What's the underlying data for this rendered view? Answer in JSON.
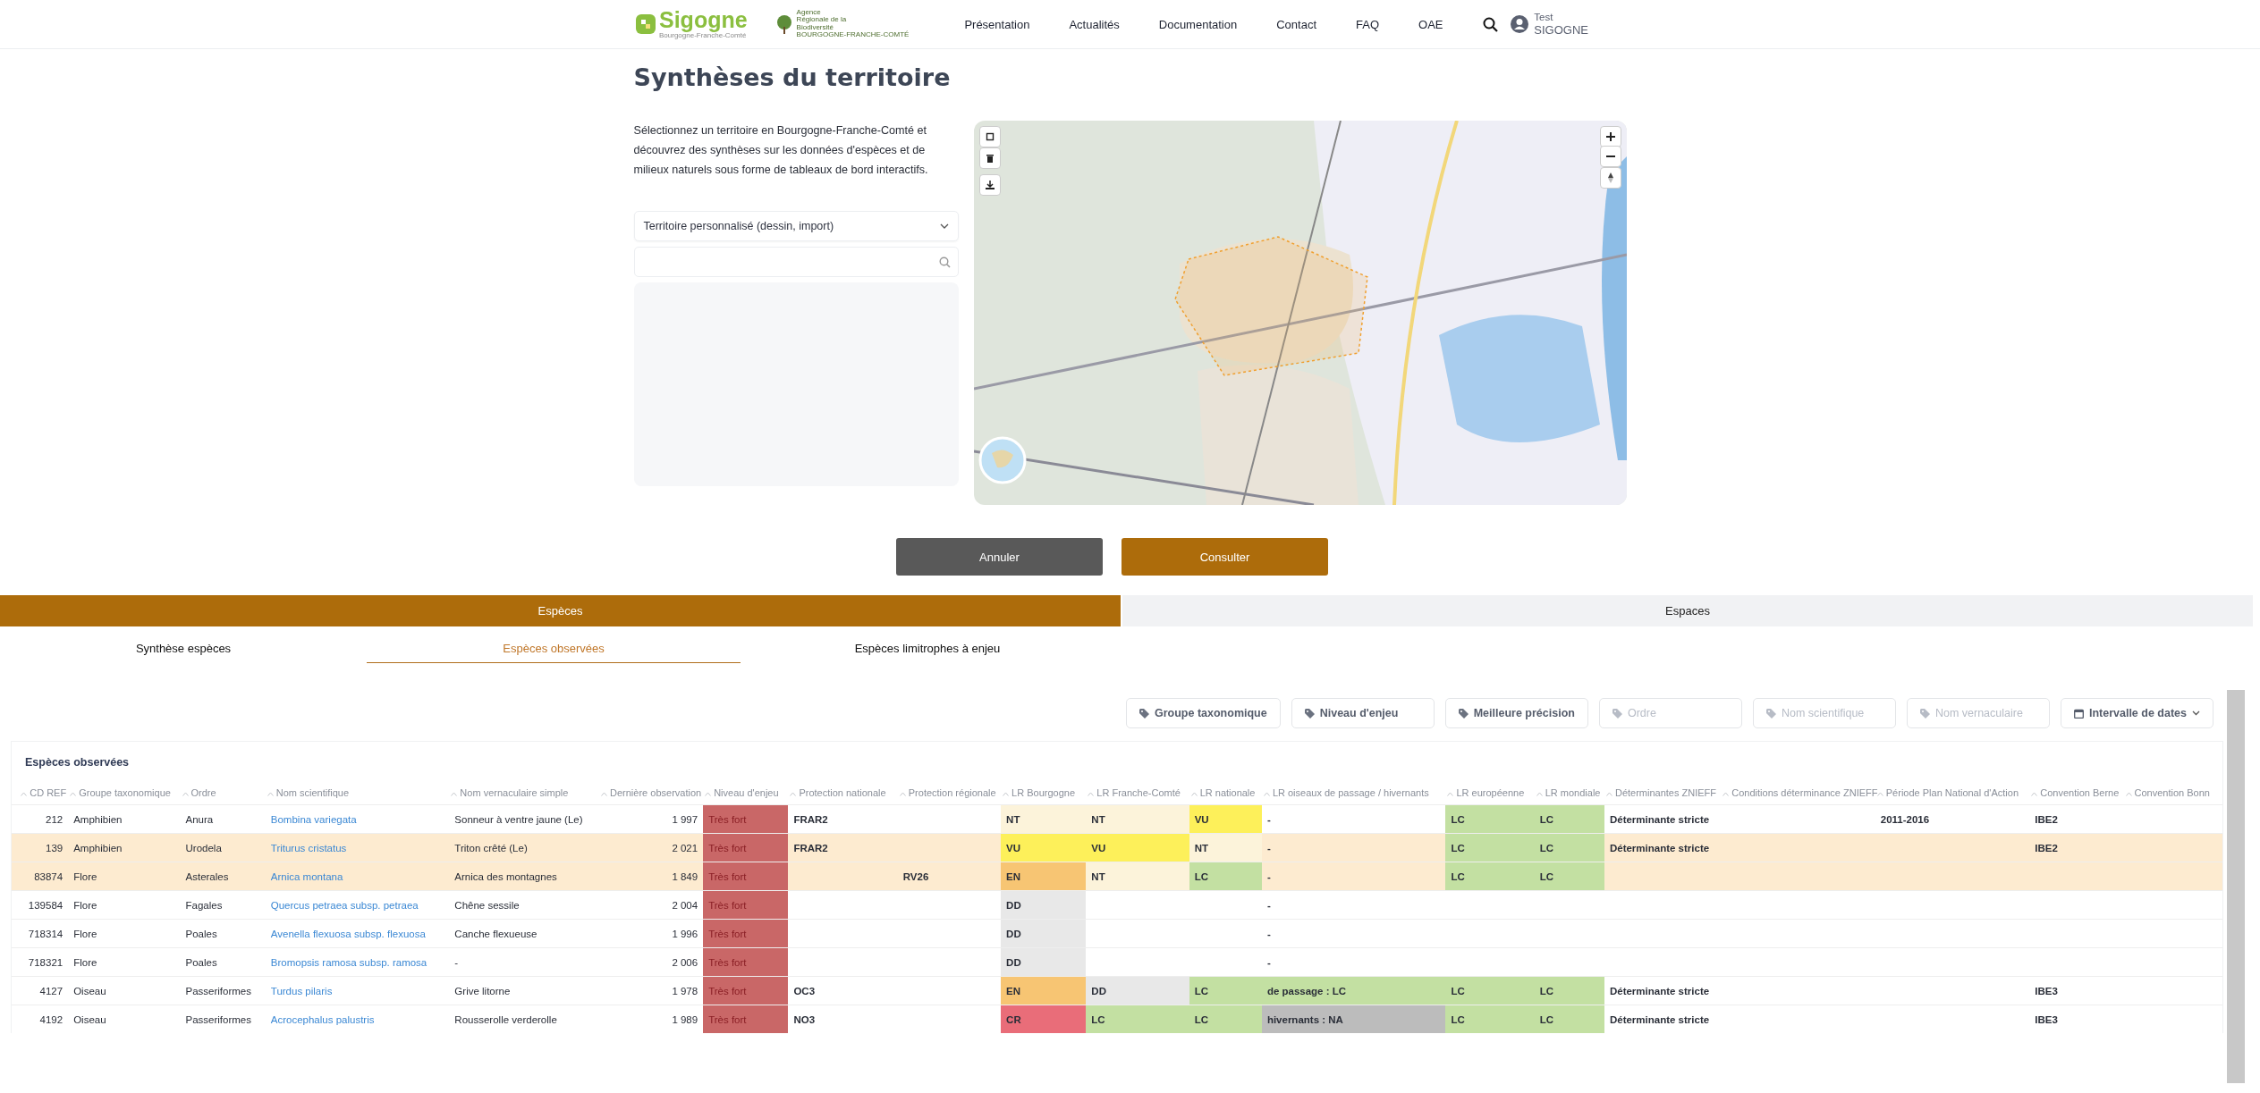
{
  "header": {
    "logo": {
      "name": "Sigogne",
      "tagline": "Bourgogne-Franche-Comté"
    },
    "partner_logo": {
      "lines": [
        "Agence",
        "Régionale de la",
        "Biodiversité"
      ],
      "region": "BOURGOGNE-FRANCHE-COMTÉ"
    },
    "nav": [
      "Présentation",
      "Actualités",
      "Documentation",
      "Contact",
      "FAQ",
      "OAE"
    ],
    "user": {
      "first": "Test",
      "last": "SIGOGNE"
    }
  },
  "title": "Synthèses du territoire",
  "intro": "Sélectionnez un territoire en Bourgogne-Franche-Comté et découvrez des synthèses sur les données d'espèces et de milieux naturels sous forme de tableaux de bord interactifs.",
  "territory_select": {
    "value": "Territoire personnalisé (dessin, import)"
  },
  "buttons": [
    {
      "label": "Annuler",
      "kind": "secondary"
    },
    {
      "label": "Consulter",
      "kind": "primary"
    }
  ],
  "main_tabs": [
    {
      "label": "Espèces",
      "selected": true
    },
    {
      "label": "Espaces",
      "selected": false
    }
  ],
  "sub_tabs": [
    {
      "label": "Synthèse espèces",
      "selected": false
    },
    {
      "label": "Espèces observées",
      "selected": true
    },
    {
      "label": "Espèces limitrophes à enjeu",
      "selected": false
    }
  ],
  "filters": [
    {
      "label": "Groupe taxonomique",
      "kind": "tag",
      "disabled": false
    },
    {
      "label": "Niveau d'enjeu",
      "kind": "tag",
      "disabled": false
    },
    {
      "label": "Meilleure précision",
      "kind": "tag",
      "disabled": false
    },
    {
      "label": "Ordre",
      "kind": "tag",
      "disabled": true
    },
    {
      "label": "Nom scientifique",
      "kind": "tag",
      "disabled": true
    },
    {
      "label": "Nom vernaculaire",
      "kind": "tag",
      "disabled": true
    },
    {
      "label": "Intervalle de dates",
      "kind": "date",
      "disabled": false
    }
  ],
  "table": {
    "title": "Espèces observées",
    "columns": [
      {
        "label": "CD REF",
        "kind": "number"
      },
      {
        "label": "Groupe taxonomique",
        "kind": "text"
      },
      {
        "label": "Ordre",
        "kind": "text"
      },
      {
        "label": "Nom scientifique",
        "kind": "link"
      },
      {
        "label": "Nom vernaculaire simple",
        "kind": "text"
      },
      {
        "label": "Dernière observation",
        "kind": "number"
      },
      {
        "label": "Niveau d'enjeu",
        "kind": "level"
      },
      {
        "label": "Protection nationale",
        "kind": "text"
      },
      {
        "label": "Protection régionale",
        "kind": "text"
      },
      {
        "label": "LR Bourgogne",
        "kind": "status"
      },
      {
        "label": "LR Franche-Comté",
        "kind": "status"
      },
      {
        "label": "LR nationale",
        "kind": "status"
      },
      {
        "label": "LR oiseaux de passage / hivernants",
        "kind": "status"
      },
      {
        "label": "LR européenne",
        "kind": "status"
      },
      {
        "label": "LR mondiale",
        "kind": "status"
      },
      {
        "label": "Déterminantes ZNIEFF",
        "kind": "text"
      },
      {
        "label": "Conditions déterminance ZNIEFF",
        "kind": "text"
      },
      {
        "label": "Période Plan National d'Action",
        "kind": "text"
      },
      {
        "label": "Convention Berne",
        "kind": "text"
      },
      {
        "label": "Convention Bonn",
        "kind": "text"
      }
    ],
    "rows": [
      {
        "highlighted": false,
        "cells": [
          "212",
          "Amphibien",
          "Anura",
          "Bombina variegata",
          "Sonneur à ventre jaune (Le)",
          "1 997",
          {
            "text": "Très fort",
            "color": "#c96767"
          },
          "FRAR2",
          null,
          {
            "text": "NT",
            "color": "#fcf3da"
          },
          {
            "text": "NT",
            "color": "#fcf3da"
          },
          {
            "text": "VU",
            "color": "#fdf05a"
          },
          {
            "text": "-"
          },
          {
            "text": "LC",
            "color": "#c3e0a2"
          },
          {
            "text": "LC",
            "color": "#c3e0a2"
          },
          "Déterminante stricte",
          null,
          "2011-2016",
          "IBE2",
          null
        ]
      },
      {
        "highlighted": true,
        "cells": [
          "139",
          "Amphibien",
          "Urodela",
          "Triturus cristatus",
          "Triton crêté (Le)",
          "2 021",
          {
            "text": "Très fort",
            "color": "#c96767"
          },
          "FRAR2",
          null,
          {
            "text": "VU",
            "color": "#fdf05a"
          },
          {
            "text": "VU",
            "color": "#fdf05a"
          },
          {
            "text": "NT",
            "color": "#fcf3da"
          },
          {
            "text": "-"
          },
          {
            "text": "LC",
            "color": "#c3e0a2"
          },
          {
            "text": "LC",
            "color": "#c3e0a2"
          },
          "Déterminante stricte",
          null,
          null,
          "IBE2",
          null
        ]
      },
      {
        "highlighted": true,
        "cells": [
          "83874",
          "Flore",
          "Asterales",
          "Arnica montana",
          "Arnica des montagnes",
          "1 849",
          {
            "text": "Très fort",
            "color": "#c96767"
          },
          null,
          "RV26",
          {
            "text": "EN",
            "color": "#f7c573"
          },
          {
            "text": "NT",
            "color": "#fcf3da"
          },
          {
            "text": "LC",
            "color": "#c3e0a2"
          },
          {
            "text": "-"
          },
          {
            "text": "LC",
            "color": "#c3e0a2"
          },
          {
            "text": "LC",
            "color": "#c3e0a2"
          },
          null,
          null,
          null,
          null,
          null
        ]
      },
      {
        "highlighted": false,
        "cells": [
          "139584",
          "Flore",
          "Fagales",
          "Quercus petraea subsp. petraea",
          "Chêne sessile",
          "2 004",
          {
            "text": "Très fort",
            "color": "#c96767"
          },
          null,
          null,
          {
            "text": "DD",
            "color": "#e8e8e8"
          },
          null,
          null,
          {
            "text": "-"
          },
          null,
          null,
          null,
          null,
          null,
          null,
          null
        ]
      },
      {
        "highlighted": false,
        "cells": [
          "718314",
          "Flore",
          "Poales",
          "Avenella flexuosa subsp. flexuosa",
          "Canche flexueuse",
          "1 996",
          {
            "text": "Très fort",
            "color": "#c96767"
          },
          null,
          null,
          {
            "text": "DD",
            "color": "#e8e8e8"
          },
          null,
          null,
          {
            "text": "-"
          },
          null,
          null,
          null,
          null,
          null,
          null,
          null
        ]
      },
      {
        "highlighted": false,
        "cells": [
          "718321",
          "Flore",
          "Poales",
          "Bromopsis ramosa subsp. ramosa",
          "-",
          "2 006",
          {
            "text": "Très fort",
            "color": "#c96767"
          },
          null,
          null,
          {
            "text": "DD",
            "color": "#e8e8e8"
          },
          null,
          null,
          {
            "text": "-"
          },
          null,
          null,
          null,
          null,
          null,
          null,
          null
        ]
      },
      {
        "highlighted": false,
        "cells": [
          "4127",
          "Oiseau",
          "Passeriformes",
          "Turdus pilaris",
          "Grive litorne",
          "1 978",
          {
            "text": "Très fort",
            "color": "#c96767"
          },
          "OC3",
          null,
          {
            "text": "EN",
            "color": "#f7c573"
          },
          {
            "text": "DD",
            "color": "#e8e8e8"
          },
          {
            "text": "LC",
            "color": "#c3e0a2"
          },
          {
            "text": "de passage : LC",
            "color": "#c3e0a2"
          },
          {
            "text": "LC",
            "color": "#c3e0a2"
          },
          {
            "text": "LC",
            "color": "#c3e0a2"
          },
          "Déterminante stricte",
          null,
          null,
          "IBE3",
          null
        ]
      },
      {
        "highlighted": false,
        "cells": [
          "4192",
          "Oiseau",
          "Passeriformes",
          "Acrocephalus palustris",
          "Rousserolle verderolle",
          "1 989",
          {
            "text": "Très fort",
            "color": "#c96767"
          },
          "NO3",
          null,
          {
            "text": "CR",
            "color": "#e96d79"
          },
          {
            "text": "LC",
            "color": "#c3e0a2"
          },
          {
            "text": "LC",
            "color": "#c3e0a2"
          },
          {
            "text": "hivernants : NA",
            "color": "#bcbcbc"
          },
          {
            "text": "LC",
            "color": "#c3e0a2"
          },
          {
            "text": "LC",
            "color": "#c3e0a2"
          },
          "Déterminante stricte",
          null,
          null,
          "IBE3",
          null
        ]
      }
    ]
  }
}
